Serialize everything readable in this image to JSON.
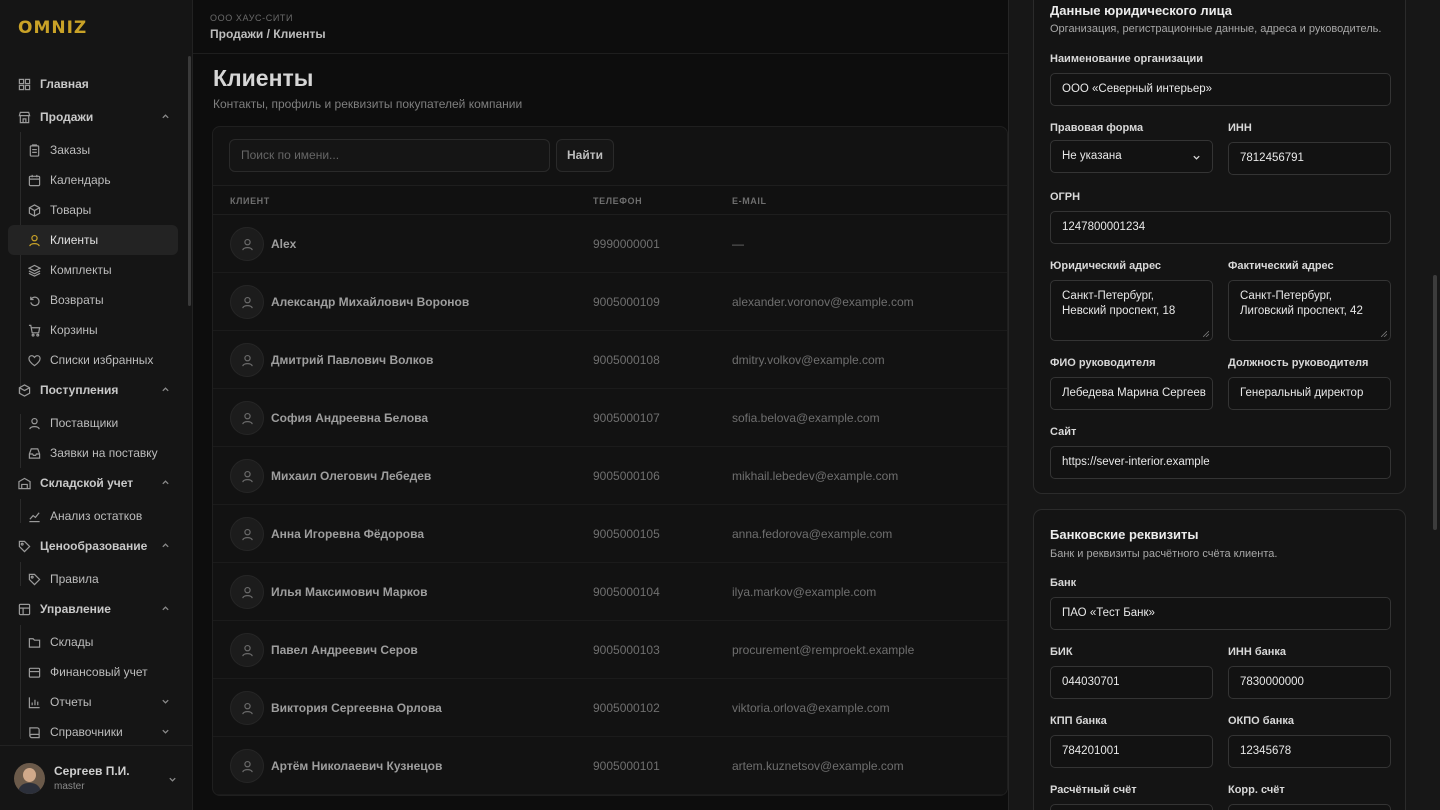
{
  "sidebar": {
    "logo": "OMNIZ",
    "items": [
      {
        "label": "Главная",
        "icon": "home-icon"
      },
      {
        "label": "Продажи",
        "icon": "store-icon"
      },
      {
        "label": "Заказы",
        "icon": "clipboard-icon"
      },
      {
        "label": "Календарь",
        "icon": "calendar-icon"
      },
      {
        "label": "Товары",
        "icon": "box-icon"
      },
      {
        "label": "Клиенты",
        "icon": "user-icon"
      },
      {
        "label": "Комплекты",
        "icon": "layers-icon"
      },
      {
        "label": "Возвраты",
        "icon": "return-icon"
      },
      {
        "label": "Корзины",
        "icon": "cart-icon"
      },
      {
        "label": "Списки избранных",
        "icon": "heart-icon"
      },
      {
        "label": "Поступления",
        "icon": "inbox-icon"
      },
      {
        "label": "Поставщики",
        "icon": "user-icon"
      },
      {
        "label": "Заявки на поставку",
        "icon": "inbox-icon"
      },
      {
        "label": "Складской учет",
        "icon": "warehouse-icon"
      },
      {
        "label": "Анализ остатков",
        "icon": "chart-icon"
      },
      {
        "label": "Ценообразование",
        "icon": "tag-icon"
      },
      {
        "label": "Правила",
        "icon": "tag-icon"
      },
      {
        "label": "Управление",
        "icon": "grid-icon"
      },
      {
        "label": "Склады",
        "icon": "folder-icon"
      },
      {
        "label": "Финансовый учет",
        "icon": "wallet-icon"
      },
      {
        "label": "Отчеты",
        "icon": "bar-chart-icon"
      },
      {
        "label": "Справочники",
        "icon": "book-icon"
      }
    ],
    "user": {
      "name": "Сергеев П.И.",
      "role": "master"
    }
  },
  "topbar": {
    "company": "ООО ХАУС-СИТИ",
    "breadcrumb": "Продажи / Клиенты"
  },
  "page": {
    "title": "Клиенты",
    "subtitle": "Контакты, профиль и реквизиты покупателей компании"
  },
  "search": {
    "placeholder": "Поиск по имени...",
    "button": "Найти"
  },
  "table": {
    "columns": [
      "КЛИЕНТ",
      "ТЕЛЕФОН",
      "E-MAIL"
    ],
    "rows": [
      {
        "name": "Alex",
        "phone": "9990000001",
        "email": "—"
      },
      {
        "name": "Александр Михайлович Воронов",
        "phone": "9005000109",
        "email": "alexander.voronov@example.com"
      },
      {
        "name": "Дмитрий Павлович Волков",
        "phone": "9005000108",
        "email": "dmitry.volkov@example.com"
      },
      {
        "name": "София Андреевна Белова",
        "phone": "9005000107",
        "email": "sofia.belova@example.com"
      },
      {
        "name": "Михаил Олегович Лебедев",
        "phone": "9005000106",
        "email": "mikhail.lebedev@example.com"
      },
      {
        "name": "Анна Игоревна Фёдорова",
        "phone": "9005000105",
        "email": "anna.fedorova@example.com"
      },
      {
        "name": "Илья Максимович Марков",
        "phone": "9005000104",
        "email": "ilya.markov@example.com"
      },
      {
        "name": "Павел Андреевич Серов",
        "phone": "9005000103",
        "email": "procurement@remproekt.example"
      },
      {
        "name": "Виктория Сергеевна Орлова",
        "phone": "9005000102",
        "email": "viktoria.orlova@example.com"
      },
      {
        "name": "Артём Николаевич Кузнецов",
        "phone": "9005000101",
        "email": "artem.kuznetsov@example.com"
      }
    ]
  },
  "legal": {
    "title": "Данные юридического лица",
    "subtitle": "Организация, регистрационные данные, адреса и руководитель.",
    "org_name_label": "Наименование организации",
    "org_name": "ООО «Северный интерьер»",
    "legal_form_label": "Правовая форма",
    "legal_form": "Не указана",
    "inn_label": "ИНН",
    "inn": "7812456791",
    "ogrn_label": "ОГРН",
    "ogrn": "1247800001234",
    "legal_address_label": "Юридический адрес",
    "legal_address": "Санкт-Петербург, Невский проспект, 18",
    "actual_address_label": "Фактический адрес",
    "actual_address": "Санкт-Петербург, Лиговский проспект, 42",
    "director_name_label": "ФИО руководителя",
    "director_name": "Лебедева Марина Сергеев",
    "director_position_label": "Должность руководителя",
    "director_position": "Генеральный директор",
    "website_label": "Сайт",
    "website": "https://sever-interior.example"
  },
  "bank": {
    "title": "Банковские реквизиты",
    "subtitle": "Банк и реквизиты расчётного счёта клиента.",
    "bank_label": "Банк",
    "bank": "ПАО «Тест Банк»",
    "bik_label": "БИК",
    "bik": "044030701",
    "bank_inn_label": "ИНН банка",
    "bank_inn": "7830000000",
    "kpp_label": "КПП банка",
    "kpp": "784201001",
    "okpo_label": "ОКПО банка",
    "okpo": "12345678",
    "account_label": "Расчётный счёт",
    "corr_account_label": "Корр. счёт"
  },
  "colors": {
    "background": "#0b0b0b",
    "panel": "#171717",
    "logo": "#c9a227"
  }
}
